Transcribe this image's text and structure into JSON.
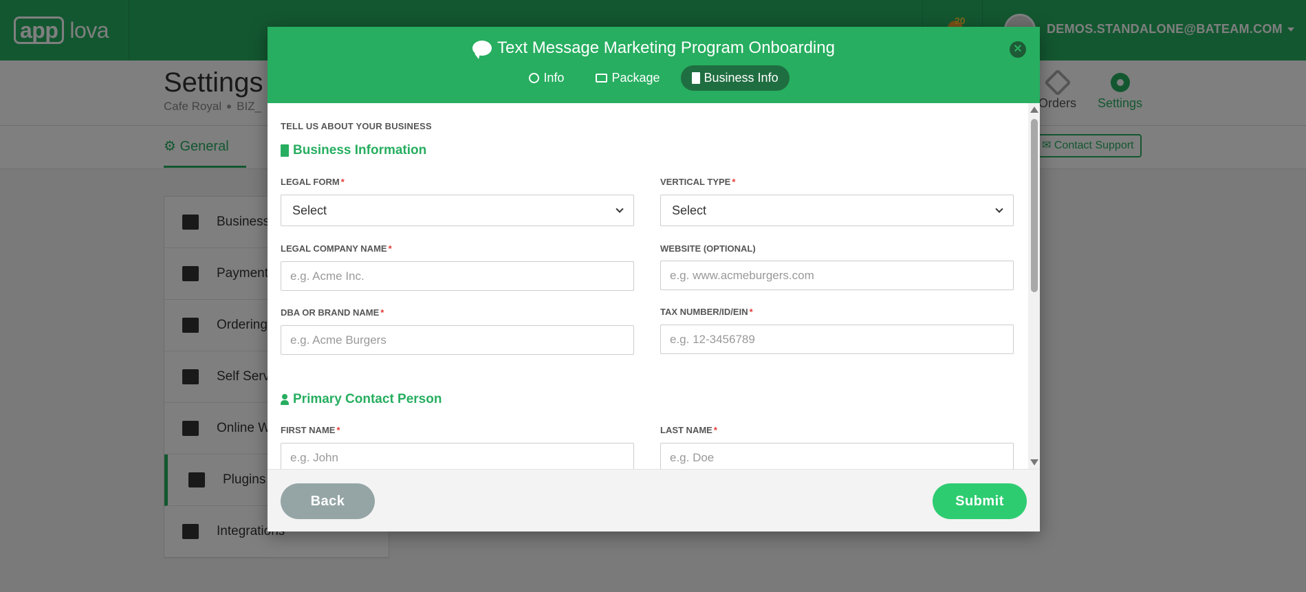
{
  "app": {
    "logo_app": "app",
    "logo_lova": "lova",
    "notification_count": "20",
    "user_email": "DEMOS.STANDALONE@BATEAM.COM"
  },
  "page": {
    "title": "Settings",
    "breadcrumb": [
      "Cafe Royal",
      "BIZ_"
    ],
    "nav": {
      "orders": "Orders",
      "settings": "Settings"
    },
    "tab_general": "General",
    "contact_support": "Contact Support",
    "side_menu": [
      {
        "label": "Business D",
        "icon": "bank-icon"
      },
      {
        "label": "Payments",
        "icon": "money-icon"
      },
      {
        "label": "Ordering M",
        "icon": "cart-icon"
      },
      {
        "label": "Self Servic",
        "icon": "monitor-icon"
      },
      {
        "label": "Online We",
        "icon": "laptop-icon"
      },
      {
        "label": "Plugins",
        "icon": "puzzle-icon",
        "active": true
      },
      {
        "label": "Integrations",
        "icon": "plug-icon"
      }
    ]
  },
  "modal": {
    "title": "Text Message Marketing Program Onboarding",
    "tabs": [
      {
        "label": "Info",
        "icon": "info-icon"
      },
      {
        "label": "Package",
        "icon": "list-icon"
      },
      {
        "label": "Business Info",
        "icon": "building-icon",
        "active": true
      }
    ],
    "intro": "TELL US ABOUT YOUR BUSINESS",
    "business_heading": "Business Information",
    "contact_heading": "Primary Contact Person",
    "fields": {
      "legal_form": {
        "label": "LEGAL FORM",
        "value": "Select",
        "required": true
      },
      "vertical_type": {
        "label": "VERTICAL TYPE",
        "value": "Select",
        "required": true
      },
      "legal_company_name": {
        "label": "LEGAL COMPANY NAME",
        "placeholder": "e.g. Acme Inc.",
        "value": "",
        "required": true
      },
      "website": {
        "label": "WEBSITE (OPTIONAL)",
        "placeholder": "e.g. www.acmeburgers.com",
        "value": "",
        "required": false
      },
      "dba_brand_name": {
        "label": "DBA OR BRAND NAME",
        "placeholder": "e.g. Acme Burgers",
        "value": "",
        "required": true
      },
      "tax_number": {
        "label": "TAX NUMBER/ID/EIN",
        "placeholder": "e.g. 12-3456789",
        "value": "",
        "required": true
      },
      "first_name": {
        "label": "FIRST NAME",
        "placeholder": "e.g. John",
        "value": "",
        "required": true
      },
      "last_name": {
        "label": "LAST NAME",
        "placeholder": "e.g. Doe",
        "value": "",
        "required": true
      }
    },
    "required_marker": "*",
    "back_label": "Back",
    "submit_label": "Submit"
  },
  "colors": {
    "brand_green": "#27ae60",
    "submit_green": "#2ecc71",
    "back_gray": "#95a5a6",
    "required_red": "#e53935"
  }
}
